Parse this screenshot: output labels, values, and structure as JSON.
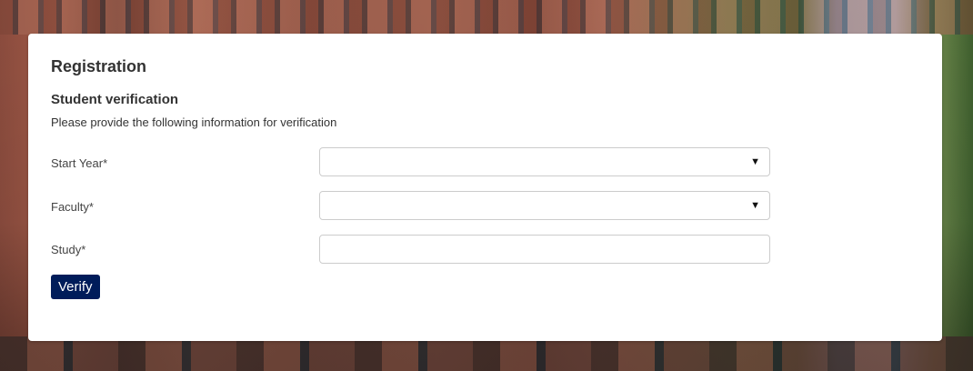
{
  "form": {
    "title": "Registration",
    "subtitle": "Student verification",
    "description": "Please provide the following information for verification",
    "fields": [
      {
        "label": "Start Year*",
        "type": "select",
        "value": "",
        "icon": "caret-down-icon"
      },
      {
        "label": "Faculty*",
        "type": "select",
        "value": "",
        "icon": "caret-down-icon"
      },
      {
        "label": "Study*",
        "type": "text",
        "value": ""
      }
    ],
    "verify_label": "Verify"
  },
  "colors": {
    "button_bg": "#001c5a",
    "button_text": "#ffffff",
    "card_bg": "#ffffff",
    "input_border": "#cccccc"
  },
  "icons": {
    "select_caret": "▼"
  }
}
